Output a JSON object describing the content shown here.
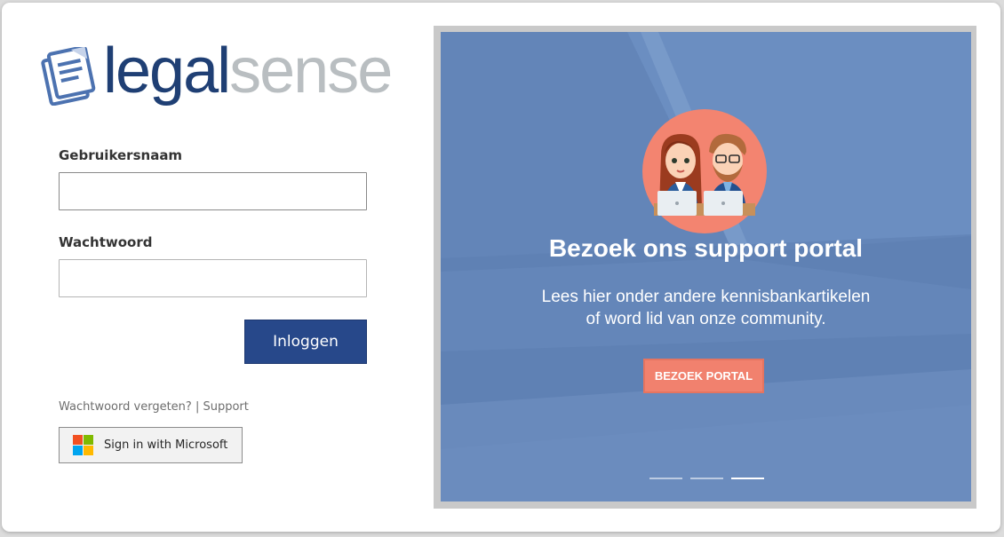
{
  "logo": {
    "text_legal": "legal",
    "text_sense": "sense",
    "icon": "document-icon"
  },
  "form": {
    "username_label": "Gebruikersnaam",
    "username_value": "",
    "password_label": "Wachtwoord",
    "password_value": "",
    "login_button": "Inloggen",
    "forgot_link": "Wachtwoord vergeten?",
    "separator": "|",
    "support_link": "Support",
    "microsoft_button": "Sign in with Microsoft"
  },
  "promo": {
    "title": "Bezoek ons support portal",
    "subtitle_line1": "Lees hier onder andere kennisbankartikelen",
    "subtitle_line2": "of word lid van onze community.",
    "button": "BEZOEK PORTAL",
    "slides": 3,
    "active_slide": 3
  },
  "colors": {
    "brand_dark_blue": "#1f3f74",
    "brand_gray": "#b9bec1",
    "login_button": "#27488a",
    "panel_blue": "#6385b8",
    "accent_salmon": "#f1816e",
    "microsoft_red": "#f25022",
    "microsoft_green": "#7fba00",
    "microsoft_blue": "#00a4ef",
    "microsoft_yellow": "#ffb900"
  }
}
